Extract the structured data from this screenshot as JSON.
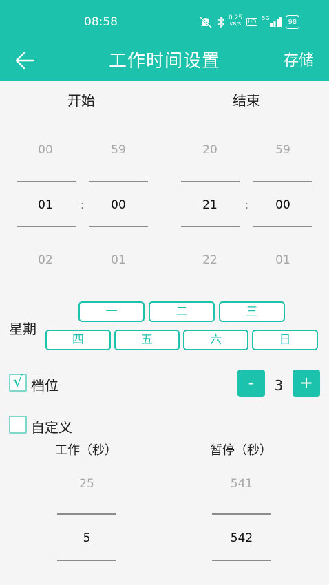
{
  "status": {
    "time": "08:58",
    "speed_top": "0.25",
    "speed_bottom": "KB/S",
    "hd": "HD",
    "signal": "5G",
    "battery": "98"
  },
  "header": {
    "title": "工作时间设置",
    "save_label": "存储"
  },
  "picker": {
    "start_label": "开始",
    "end_label": "结束",
    "start_hour": {
      "prev": "00",
      "selected": "01",
      "next": "02"
    },
    "start_minute": {
      "prev": "59",
      "selected": "00",
      "next": "01"
    },
    "end_hour": {
      "prev": "20",
      "selected": "21",
      "next": "22"
    },
    "end_minute": {
      "prev": "59",
      "selected": "00",
      "next": "01"
    },
    "separator": ":"
  },
  "week": {
    "label": "星期",
    "days": [
      "一",
      "二",
      "三",
      "四",
      "五",
      "六",
      "日"
    ]
  },
  "gear": {
    "label": "档位",
    "checked": true,
    "check_mark": "√",
    "minus": "-",
    "value": "3",
    "plus": "+"
  },
  "custom": {
    "label": "自定义",
    "checked": false,
    "work_label": "工作（秒）",
    "pause_label": "暂停（秒）",
    "work": {
      "prev": "25",
      "selected": "5"
    },
    "pause": {
      "prev": "541",
      "selected": "542"
    }
  },
  "colors": {
    "accent": "#1cc2ab",
    "background": "#f5f5f5"
  }
}
